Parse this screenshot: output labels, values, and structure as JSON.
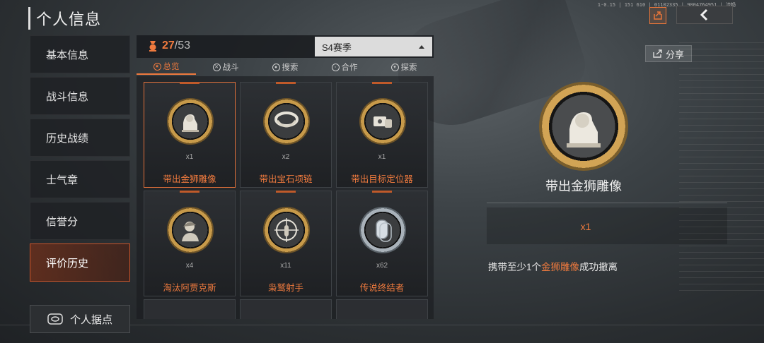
{
  "page_title": "个人信息",
  "status_strip": "1·0.15 | 151 610 | 01102335 | 9004764951 | 流畅",
  "colors": {
    "accent": "#ef7a3e",
    "gold": "#c79a4a",
    "silver": "#a9b2ba"
  },
  "sidebar": {
    "items": [
      {
        "label": "基本信息",
        "active": false
      },
      {
        "label": "战斗信息",
        "active": false
      },
      {
        "label": "历史战绩",
        "active": false
      },
      {
        "label": "士气章",
        "active": false
      },
      {
        "label": "信誉分",
        "active": false
      },
      {
        "label": "评价历史",
        "active": true
      }
    ],
    "base_button": {
      "label": "个人据点",
      "icon": "base-icon"
    }
  },
  "progress": {
    "current": "27",
    "separator": "/",
    "total": "53",
    "icon": "medal-icon"
  },
  "season_select": {
    "selected": "S4赛季",
    "icon": "caret-up-icon"
  },
  "tabs": [
    {
      "label": "总览",
      "active": true,
      "icon": "overview-icon"
    },
    {
      "label": "战斗",
      "active": false,
      "icon": "combat-icon"
    },
    {
      "label": "搜索",
      "active": false,
      "icon": "search-icon"
    },
    {
      "label": "合作",
      "active": false,
      "icon": "cooperate-icon"
    },
    {
      "label": "探索",
      "active": false,
      "icon": "explore-icon"
    }
  ],
  "achievements": [
    {
      "name": "带出金狮雕像",
      "qty": "x1",
      "icon": "lion-statue-icon",
      "selected": true,
      "tier": "gold"
    },
    {
      "name": "带出宝石项链",
      "qty": "x2",
      "icon": "necklace-icon",
      "selected": false,
      "tier": "gold"
    },
    {
      "name": "带出目标定位器",
      "qty": "x1",
      "icon": "locator-icon",
      "selected": false,
      "tier": "gold"
    },
    {
      "name": "淘汰阿贾克斯",
      "qty": "x4",
      "icon": "operator-portrait-icon",
      "selected": false,
      "tier": "gold"
    },
    {
      "name": "枭鹫射手",
      "qty": "x11",
      "icon": "crosshair-icon",
      "selected": false,
      "tier": "gold"
    },
    {
      "name": "传说终结者",
      "qty": "x62",
      "icon": "dogtag-icon",
      "selected": false,
      "tier": "silver"
    }
  ],
  "detail": {
    "share_label": "分享",
    "name": "带出金狮雕像",
    "qty": "x1",
    "desc_before": "携带至少1个",
    "desc_highlight": "金狮雕像",
    "desc_after": "成功撤离",
    "icon": "lion-statue-icon"
  }
}
